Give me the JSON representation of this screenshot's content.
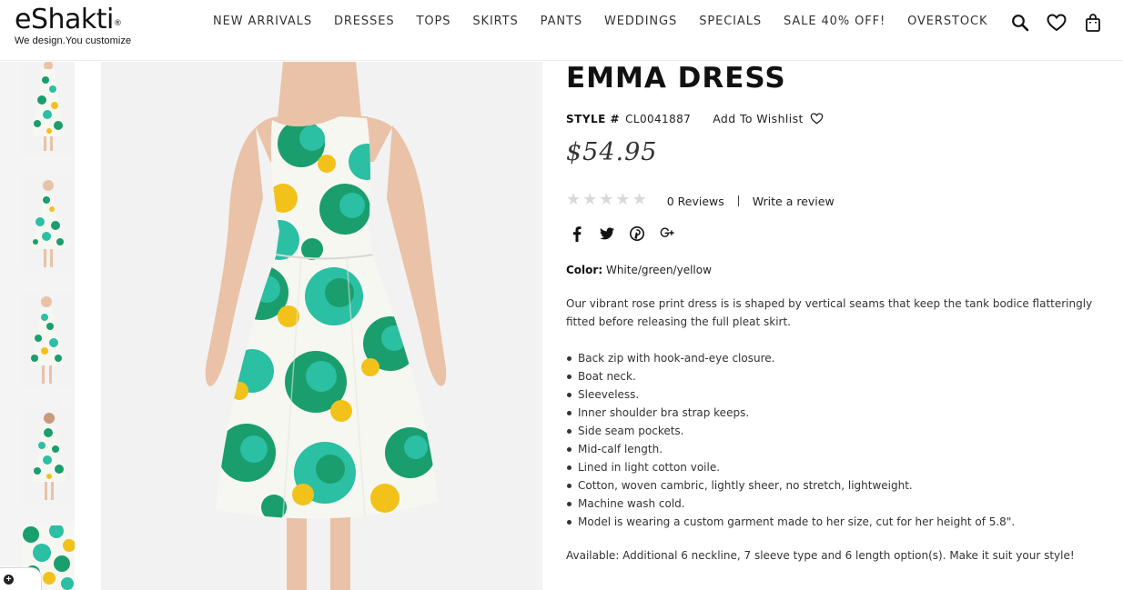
{
  "brand": {
    "name": "eShakti",
    "registered_mark": "®",
    "tagline": "We design.You customize"
  },
  "nav": {
    "items": [
      {
        "label": "NEW ARRIVALS"
      },
      {
        "label": "DRESSES"
      },
      {
        "label": "TOPS"
      },
      {
        "label": "SKIRTS"
      },
      {
        "label": "PANTS"
      },
      {
        "label": "WEDDINGS"
      },
      {
        "label": "SPECIALS"
      },
      {
        "label": "SALE 40% OFF!"
      },
      {
        "label": "OVERSTOCK"
      }
    ]
  },
  "header_icons": [
    "search-icon",
    "heart-icon",
    "shopping-bag-icon"
  ],
  "gallery": {
    "thumbnail_count": 5,
    "selected_thumbnail": 1
  },
  "product": {
    "title": "EMMA DRESS",
    "style_label": "STYLE #",
    "style_code": "CL0041887",
    "wishlist_label": "Add To Wishlist",
    "price": "$54.95",
    "rating": 0,
    "rating_max": 5,
    "reviews_label": "0 Reviews",
    "write_review_label": "Write a review",
    "social_icons": [
      "facebook-icon",
      "twitter-icon",
      "pinterest-icon",
      "google-plus-icon"
    ],
    "color_label": "Color:",
    "color_value": "White/green/yellow",
    "description": "Our vibrant rose print dress is is shaped by vertical seams that keep the tank bodice flatteringly fitted before releasing the full pleat skirt.",
    "features": [
      "Back zip with hook-and-eye closure.",
      "Boat neck.",
      "Sleeveless.",
      "Inner shoulder bra strap keeps.",
      "Side seam pockets.",
      "Mid-calf length.",
      "Lined in light cotton voile.",
      "Cotton, woven cambric, lightly sheer, no stretch, lightweight.",
      "Machine wash cold.",
      "Model is wearing a custom garment made to her size, cut for her height of 5.8\"."
    ],
    "available_text": "Available: Additional 6 neckline, 7 sleeve type and 6 length option(s). Make it suit your style!"
  },
  "colors": {
    "print_green": "#1a9e6e",
    "print_teal": "#2bbfa3",
    "print_yellow": "#f2c21b",
    "dress_white": "#f7f7f2",
    "skin": "#e9c2a8",
    "star_empty": "#d8d8d8"
  }
}
